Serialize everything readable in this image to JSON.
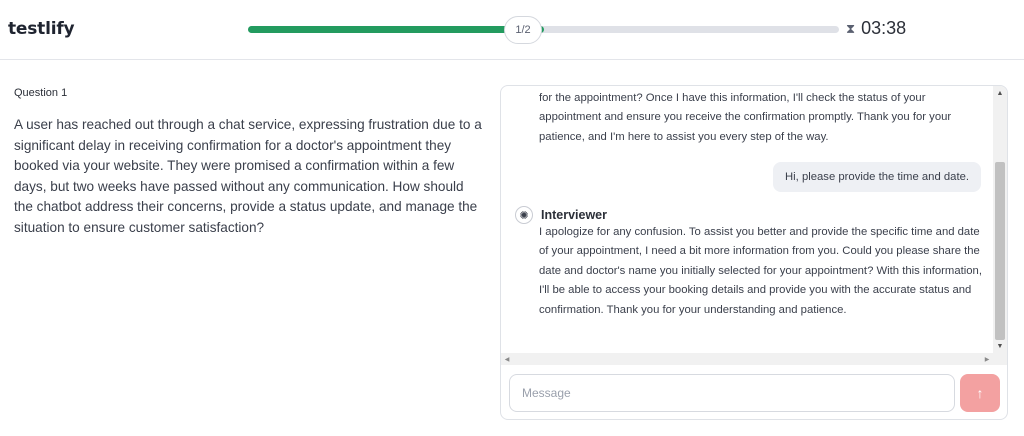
{
  "header": {
    "logo": "testlify",
    "progress": {
      "label": "1/2",
      "fraction": 0.5,
      "color": "#239b5f"
    },
    "timer": {
      "icon": "hourglass-icon",
      "time": "03:38"
    }
  },
  "question": {
    "label": "Question 1",
    "text": "A user has reached out through a chat service, expressing frustration due to a significant delay in receiving confirmation for a doctor's appointment they booked via your website. They were promised a confirmation within a few days, but two weeks have passed without any communication. How should the chatbot address their concerns, provide a status update, and manage the situation to ensure customer satisfaction?"
  },
  "chat": {
    "messages": [
      {
        "role": "interviewer",
        "text": "for the appointment? Once I have this information, I'll check the status of your appointment and ensure you receive the confirmation promptly. Thank you for your patience, and I'm here to assist you every step of the way."
      },
      {
        "role": "user",
        "text": "Hi, please provide the time and date."
      },
      {
        "role": "interviewer",
        "name": "Interviewer",
        "text": "I apologize for any confusion. To assist you better and provide the specific time and date of your appointment, I need a bit more information from you. Could you please share the date and doctor's name you initially selected for your appointment? With this information, I'll be able to access your booking details and provide you with the accurate status and confirmation. Thank you for your understanding and patience."
      }
    ],
    "input": {
      "placeholder": "Message",
      "value": ""
    },
    "send_icon": "arrow-up-icon",
    "send_color": "#f3a1a1"
  }
}
